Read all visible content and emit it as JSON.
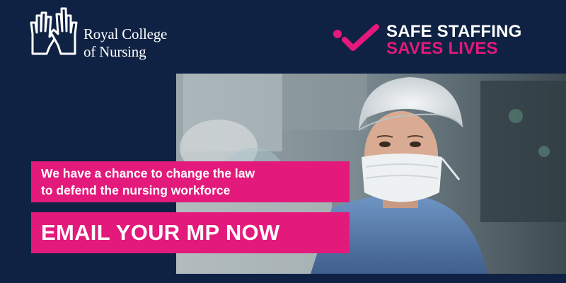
{
  "brand": {
    "logo_icon": "rcn-hands-icon",
    "name_line1": "Royal College",
    "name_line2": "of Nursing"
  },
  "campaign": {
    "icon": "dot-check-icon",
    "line1": "SAFE STAFFING",
    "line2": "SAVES LIVES"
  },
  "message": {
    "line1": "We have a chance to change the law",
    "line2": "to defend the nursing workforce"
  },
  "cta": {
    "label": "EMAIL YOUR MP NOW"
  },
  "colors": {
    "background": "#0f2243",
    "accent": "#e3197b",
    "text": "#ffffff"
  }
}
